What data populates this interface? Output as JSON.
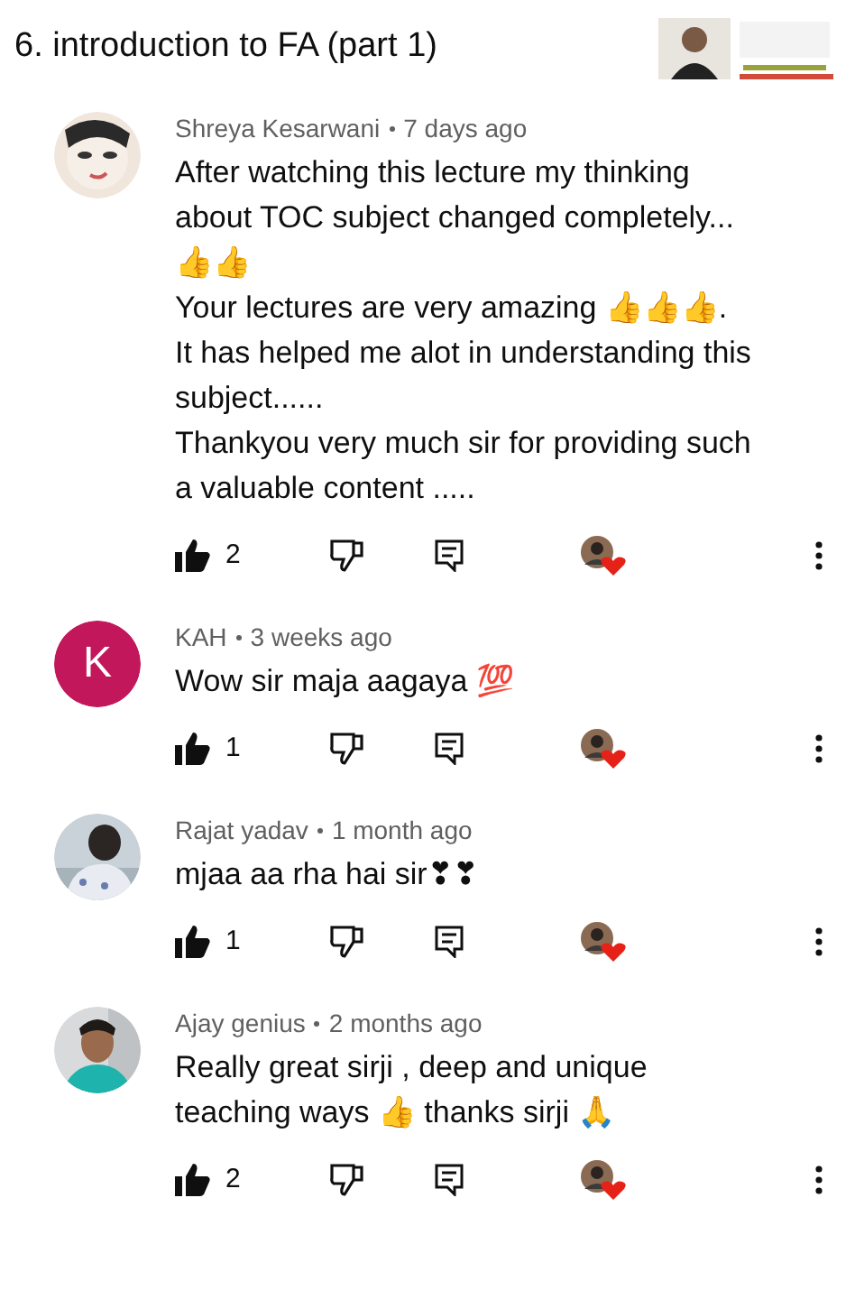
{
  "header": {
    "title": "6. introduction to FA (part 1)"
  },
  "comments": [
    {
      "author": "Shreya Kesarwani",
      "time": "7 days ago",
      "text": "After watching this lecture my thinking about TOC  subject changed completely... 👍👍\nYour lectures are very amazing 👍👍👍.\nIt has helped me alot in understanding this subject......\nThankyou very much sir for providing such a valuable content .....",
      "likes": "2",
      "liked": true,
      "hearted": true
    },
    {
      "author": "KAH",
      "time": "3 weeks ago",
      "avatar": {
        "kind": "letter",
        "letter": "K",
        "color": "#c2185b"
      },
      "text": "Wow sir maja aagaya 💯",
      "likes": "1",
      "liked": true,
      "hearted": true
    },
    {
      "author": "Rajat yadav",
      "time": "1 month ago",
      "text": "mjaa aa rha hai sir❣❣",
      "likes": "1",
      "liked": true,
      "hearted": true
    },
    {
      "author": "Ajay genius",
      "time": "2 months ago",
      "text": "Really great sirji , deep and unique teaching ways 👍 thanks sirji 🙏",
      "likes": "2",
      "liked": true,
      "hearted": true
    }
  ]
}
